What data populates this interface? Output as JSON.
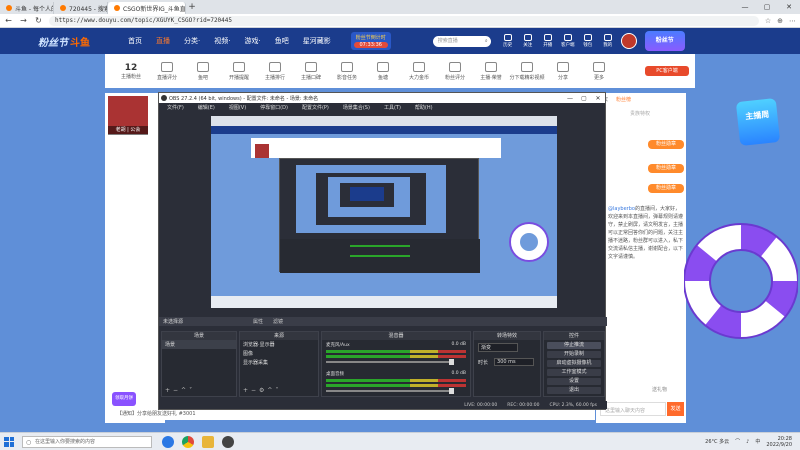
{
  "browser": {
    "tabs": [
      {
        "label": "斗鱼 - 每个人的直播平台",
        "active": false
      },
      {
        "label": "720445 - 搜索结果 - 斗鱼直播",
        "active": false
      },
      {
        "label": "CSGO新世界IG_斗鱼直播平台",
        "active": true
      }
    ],
    "new_tab": "+",
    "window_controls": [
      "—",
      "▢",
      "✕"
    ],
    "url": "https://www.douyu.com/topic/XGUYK_CSGO?rid=720445",
    "nav": [
      "←",
      "→",
      "↻"
    ],
    "addr_icons": [
      "☆",
      "⊕",
      "⋯"
    ]
  },
  "site": {
    "logo_text_1": "粉丝节",
    "logo_text_2": "斗鱼",
    "nav": [
      {
        "label": "首页",
        "active": false
      },
      {
        "label": "直播",
        "active": true
      },
      {
        "label": "分类·",
        "active": false
      },
      {
        "label": "视频·",
        "active": false
      },
      {
        "label": "游戏·",
        "active": false
      },
      {
        "label": "鱼吧",
        "active": false
      },
      {
        "label": "星河藏影",
        "active": false
      }
    ],
    "activity": {
      "title": "粉丝节倒计时",
      "countdown": "07:33:36"
    },
    "search_placeholder": "搜索直播",
    "user_icons": [
      "历史",
      "关注",
      "开播",
      "客户端",
      "钱包",
      "我的"
    ],
    "promo": "粉丝节"
  },
  "categories": {
    "count": "12",
    "count_label": "主播粉丝",
    "items": [
      "直播评分",
      "鱼吧",
      "开播提醒",
      "主播排行",
      "主播口碑",
      "影音任务",
      "鱼塘",
      "大力金币",
      "粉丝评分",
      "主播·荣誉",
      "分下载精彩视频",
      "分享",
      "更多"
    ],
    "pc_button": "PC客户端"
  },
  "streamer": {
    "name": "老胡 | 公会"
  },
  "chat": {
    "tabs": [
      {
        "label": "贵宾",
        "active": false
      },
      {
        "label": "粉丝榜",
        "active": true
      }
    ],
    "subtab": "贵族特权",
    "badges": [
      "粉丝勋章",
      "粉丝勋章",
      "粉丝勋章"
    ],
    "message_user": "@layberbo",
    "message_text": "的直播间，大家好，欢迎来到本直播间，弹幕规则请遵守，禁止刷屏，请文明发言，主播可以正常回答你们的问题，关注主播不迷路，粉丝群可以进入，私下交流请私信主播，谢谢配合，以下文字请谨慎。",
    "input_placeholder": "这里输入聊天内容",
    "send": "发送",
    "gift_notice": "送礼物"
  },
  "below_bar": "【通知】分享给朋友送好礼 #3001",
  "left_badge": "领取月饼",
  "float_promo": "主播周",
  "obs": {
    "title": "OBS 27.2.4 (64 bit, windows) - 配置文件: 未命名 - 场景: 未命名",
    "menu": [
      "文件(F)",
      "编辑(E)",
      "视图(V)",
      "停靠窗口(D)",
      "配置文件(P)",
      "场景集合(S)",
      "工具(T)",
      "帮助(H)"
    ],
    "preview_bar": [
      "未选择源",
      "属性",
      "滤镜"
    ],
    "docks": {
      "scenes": {
        "title": "场景",
        "items": [
          "场景"
        ]
      },
      "sources": {
        "title": "来源",
        "items": [
          "浏览器·显示器",
          "图像",
          "显示器采集"
        ]
      },
      "mixer": {
        "title": "混音器",
        "channels": [
          {
            "name": "麦克风/Aux",
            "db": "0.0 dB"
          },
          {
            "name": "桌面音频",
            "db": "0.0 dB"
          }
        ]
      },
      "transitions": {
        "title": "转场特效",
        "type": "渐变",
        "duration_label": "时长",
        "duration": "300 ms"
      },
      "controls": {
        "title": "控件",
        "buttons": [
          "停止推流",
          "开始录制",
          "启动虚拟摄像机",
          "工作室模式",
          "设置",
          "退出"
        ]
      }
    },
    "status": [
      "LIVE: 00:00:00",
      "REC: 00:00:00",
      "CPU: 2.3%, 60.00 fps"
    ]
  },
  "taskbar": {
    "search_placeholder": "在这里输入你要搜索的内容",
    "temp": "26°C 多云",
    "lang": "中",
    "time": "20:28",
    "date": "2022/9/20",
    "app_colors": [
      "#2b78e4",
      "#1aa260",
      "#e04a3b",
      "#444444"
    ]
  }
}
